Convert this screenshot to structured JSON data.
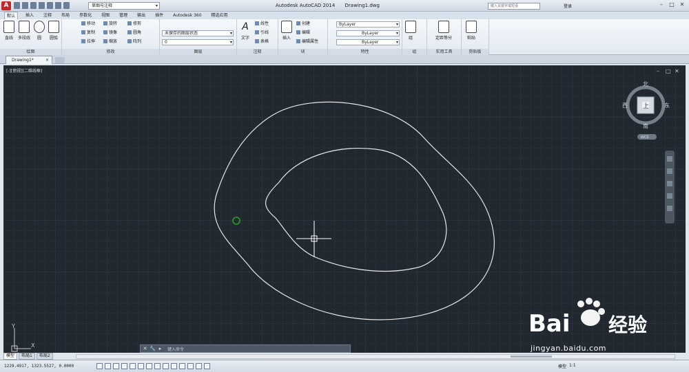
{
  "app": {
    "logo_letter": "A",
    "workspace": "草图与注释",
    "title": "Autodesk AutoCAD 2014",
    "file": "Drawing1.dwg",
    "search_placeholder": "键入关键字或短语",
    "login": "登录"
  },
  "tabs": [
    "默认",
    "插入",
    "注释",
    "布局",
    "参数化",
    "视图",
    "管理",
    "输出",
    "插件",
    "Autodesk 360",
    "精选应用"
  ],
  "ribbon": {
    "draw": {
      "title": "绘图",
      "line": "直线",
      "polyline": "多段线",
      "circle": "圆",
      "arc": "圆弧"
    },
    "modify": {
      "title": "修改",
      "move": "移动",
      "rotate": "旋转",
      "trim": "修剪",
      "copy": "复制",
      "mirror": "镜像",
      "fillet": "圆角",
      "stretch": "拉伸",
      "scale": "缩放",
      "array": "阵列"
    },
    "layers": {
      "title": "图层",
      "state": "未保存的图层状态",
      "current": "0"
    },
    "annotation": {
      "title": "注释",
      "text": "文字",
      "linear": "线性",
      "leader": "引线",
      "table": "表格"
    },
    "block": {
      "title": "块",
      "insert": "插入",
      "create": "创建",
      "edit": "编辑",
      "edit_attr": "编辑属性"
    },
    "properties": {
      "title": "特性",
      "color": "ByLayer",
      "linetype": "ByLayer",
      "lineweight": "ByLayer"
    },
    "groups": {
      "title": "组",
      "group": "组"
    },
    "utilities": {
      "title": "实用工具",
      "measure": "测量",
      "define": "定距等分"
    },
    "clipboard": {
      "title": "剪贴板",
      "paste": "粘贴"
    }
  },
  "document_tab": "Drawing1*",
  "viewport_label": "[-][俯视][二维线框]",
  "viewcube": {
    "north": "北",
    "south": "南",
    "east": "东",
    "west": "西",
    "top": "上",
    "wcs": "WCS"
  },
  "ucs": {
    "x": "X",
    "y": "Y"
  },
  "command_prompt": "键入命令",
  "layout_tabs": [
    "模型",
    "布局1",
    "布局2"
  ],
  "status": {
    "coords": "1229.4917, 1323.5527, 0.0000",
    "model": "模型",
    "scale": "1:1"
  },
  "watermark": {
    "brand": "Bai",
    "suffix": "经验",
    "url": "jingyan.baidu.com"
  }
}
